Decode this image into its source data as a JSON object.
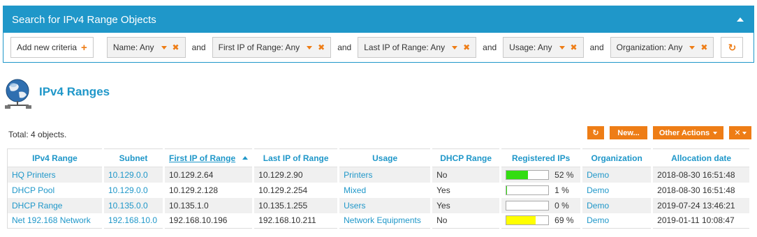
{
  "search": {
    "title": "Search for IPv4 Range Objects",
    "add_label": "Add new criteria",
    "and_label": "and",
    "criteria": [
      {
        "label": "Name: Any"
      },
      {
        "label": "First IP of Range: Any"
      },
      {
        "label": "Last IP of Range: Any"
      },
      {
        "label": "Usage: Any"
      },
      {
        "label": "Organization: Any"
      }
    ]
  },
  "page": {
    "title": "IPv4 Ranges",
    "total": "Total: 4 objects."
  },
  "toolbar": {
    "refresh_icon": "refresh-icon",
    "new_label": "New...",
    "other_actions_label": "Other Actions",
    "tools_icon": "tools-icon"
  },
  "colors": {
    "accent": "#1f97c9",
    "orange": "#ee7d16"
  },
  "table": {
    "headers": [
      "IPv4 Range",
      "Subnet",
      "First IP of Range",
      "Last IP of Range",
      "Usage",
      "DHCP Range",
      "Registered IPs",
      "Organization",
      "Allocation date"
    ],
    "sorted_column": "First IP of Range",
    "rows": [
      {
        "name": "HQ Printers",
        "subnet": "10.129.0.0",
        "first": "10.129.2.64",
        "last": "10.129.2.90",
        "usage": "Printers",
        "dhcp": "No",
        "registered": "52 %",
        "fill": 0.52,
        "fill_color": "#33dd11",
        "org": "Demo",
        "date": "2018-08-30 16:51:48"
      },
      {
        "name": "DHCP Pool",
        "subnet": "10.129.0.0",
        "first": "10.129.2.128",
        "last": "10.129.2.254",
        "usage": "Mixed",
        "dhcp": "Yes",
        "registered": "1 %",
        "fill": 0.01,
        "fill_color": "#33dd11",
        "org": "Demo",
        "date": "2018-08-30 16:51:48"
      },
      {
        "name": "DHCP Range",
        "subnet": "10.135.0.0",
        "first": "10.135.1.0",
        "last": "10.135.1.255",
        "usage": "Users",
        "dhcp": "Yes",
        "registered": "0 %",
        "fill": 0,
        "fill_color": "#33dd11",
        "org": "Demo",
        "date": "2019-07-24 13:46:21"
      },
      {
        "name": "Net 192.168 Network",
        "subnet": "192.168.10.0",
        "first": "192.168.10.196",
        "last": "192.168.10.211",
        "usage": "Network Equipments",
        "dhcp": "No",
        "registered": "69 %",
        "fill": 0.69,
        "fill_color": "#ffff00",
        "org": "Demo",
        "date": "2019-01-11 10:08:47"
      }
    ]
  }
}
